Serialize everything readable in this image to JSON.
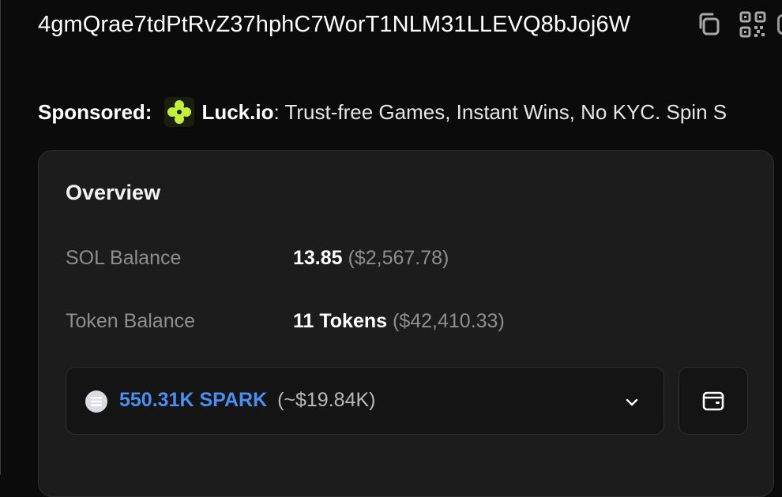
{
  "account": {
    "address": "4gmQrae7tdPtRvZ37hphC7WorT1NLM31LLEVQ8bJoj6W",
    "copy_icon": "copy-icon",
    "qr_icon": "qr-code-icon"
  },
  "sponsored": {
    "label": "Sponsored:",
    "logo_icon": "luck-io-logo",
    "name": "Luck.io",
    "text": ": Trust-free Games, Instant Wins, No KYC. Spin S"
  },
  "overview": {
    "title": "Overview",
    "sol_balance": {
      "label": "SOL Balance",
      "amount": "13.85",
      "usd": "($2,567.78)"
    },
    "token_balance": {
      "label": "Token Balance",
      "amount": "11 Tokens",
      "usd": "($42,410.33)"
    },
    "token_select": {
      "amount": "550.31K SPARK",
      "usd": "(~$19.84K)",
      "icon": "solana-token-icon",
      "chevron": "chevron-down-icon"
    },
    "wallet_icon": "wallet-icon"
  },
  "colors": {
    "background": "#0b0b0b",
    "card": "#1c1c1c",
    "accent_blue": "#4a8ff0",
    "muted_text": "#8e8e8e",
    "logo_green": "#c4f03a"
  }
}
